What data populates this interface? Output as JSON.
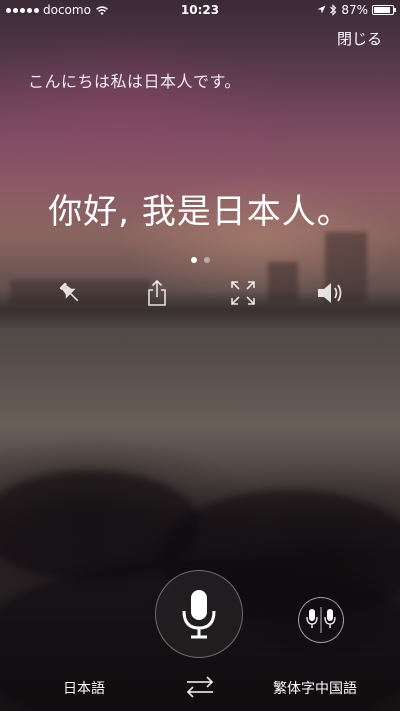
{
  "status_bar": {
    "carrier": "docomo",
    "time": "10:23",
    "battery": "87%",
    "battery_level": 0.87,
    "icons": [
      "signal-dots-icon",
      "wifi-icon",
      "location-arrow-icon",
      "bluetooth-icon",
      "battery-icon"
    ]
  },
  "header": {
    "close_label": "閉じる"
  },
  "source": {
    "text": "こんにちは私は日本人です。"
  },
  "translation": {
    "text": "你好, 我是日本人。"
  },
  "pager": {
    "pages": 2,
    "active_index": 0
  },
  "actions": [
    {
      "name": "pin",
      "icon": "pin-icon"
    },
    {
      "name": "share",
      "icon": "share-icon"
    },
    {
      "name": "fullscreen",
      "icon": "expand-icon"
    },
    {
      "name": "speak",
      "icon": "speaker-icon"
    }
  ],
  "controls": {
    "mic_icon": "microphone-icon",
    "conversation_icon": "dual-microphone-icon",
    "swap_icon": "swap-arrows-icon",
    "source_language": "日本語",
    "target_language": "繁体字中国語"
  }
}
